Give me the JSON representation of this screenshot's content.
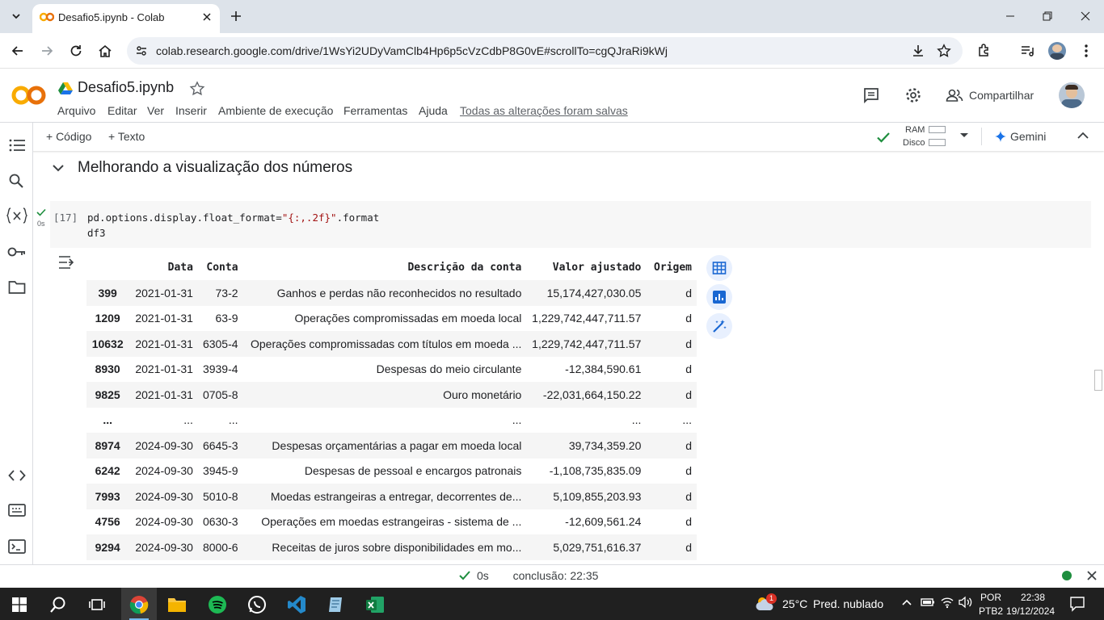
{
  "browser": {
    "tab_title": "Desafio5.ipynb - Colab",
    "url": "colab.research.google.com/drive/1WsYi2UDyVamClb4Hp6p5cVzCdbP8G0vE#scrollTo=cgQJraRi9kWj"
  },
  "colab": {
    "logo": "CO",
    "notebook_title": "Desafio5.ipynb",
    "menu": [
      "Arquivo",
      "Editar",
      "Ver",
      "Inserir",
      "Ambiente de execução",
      "Ferramentas",
      "Ajuda"
    ],
    "saved_status": "Todas as alterações foram salvas",
    "share_label": "Compartilhar",
    "add_code": "+ Código",
    "add_text": "+ Texto",
    "ram_label": "RAM",
    "disk_label": "Disco",
    "gemini_label": "Gemini"
  },
  "section": {
    "title": "Melhorando a visualização dos números"
  },
  "cell": {
    "exec_count": "[17]",
    "exec_time": "0s",
    "code_line1_a": "pd.options.display.float_format=",
    "code_line1_str": "\"{:,.2f}\"",
    "code_line1_b": ".format",
    "code_line2": "df3"
  },
  "dataframe": {
    "columns": [
      "",
      "Data",
      "Conta",
      "Descrição da conta",
      "Valor ajustado",
      "Origem"
    ],
    "rows": [
      [
        "399",
        "2021-01-31",
        "73-2",
        "Ganhos e perdas não reconhecidos no resultado",
        "15,174,427,030.05",
        "d"
      ],
      [
        "1209",
        "2021-01-31",
        "63-9",
        "Operações compromissadas em moeda local",
        "1,229,742,447,711.57",
        "d"
      ],
      [
        "10632",
        "2021-01-31",
        "6305-4",
        "Operações compromissadas com títulos em moeda ...",
        "1,229,742,447,711.57",
        "d"
      ],
      [
        "8930",
        "2021-01-31",
        "3939-4",
        "Despesas do meio circulante",
        "-12,384,590.61",
        "d"
      ],
      [
        "9825",
        "2021-01-31",
        "0705-8",
        "Ouro monetário",
        "-22,031,664,150.22",
        "d"
      ],
      [
        "...",
        "...",
        "...",
        "...",
        "...",
        "..."
      ],
      [
        "8974",
        "2024-09-30",
        "6645-3",
        "Despesas orçamentárias a pagar em moeda local",
        "39,734,359.20",
        "d"
      ],
      [
        "6242",
        "2024-09-30",
        "3945-9",
        "Despesas de pessoal e encargos patronais",
        "-1,108,735,835.09",
        "d"
      ],
      [
        "7993",
        "2024-09-30",
        "5010-8",
        "Moedas estrangeiras a entregar, decorrentes de...",
        "5,109,855,203.93",
        "d"
      ],
      [
        "4756",
        "2024-09-30",
        "0630-3",
        "Operações em moedas estrangeiras - sistema de ...",
        "-12,609,561.24",
        "d"
      ],
      [
        "9294",
        "2024-09-30",
        "8000-6",
        "Receitas de juros sobre disponibilidades em mo...",
        "5,029,751,616.37",
        "d"
      ]
    ]
  },
  "statusbar": {
    "time": "0s",
    "completion": "conclusão: 22:35"
  },
  "taskbar": {
    "weather_badge": "1",
    "weather_temp": "25°C",
    "weather_desc": "Pred. nublado",
    "lang_top": "POR",
    "lang_bottom": "PTB2",
    "clock_time": "22:38",
    "clock_date": "19/12/2024"
  },
  "colors": {
    "accent_orange": "#f9ab00",
    "success_green": "#1e8e3e",
    "link_blue": "#1a73e8"
  }
}
